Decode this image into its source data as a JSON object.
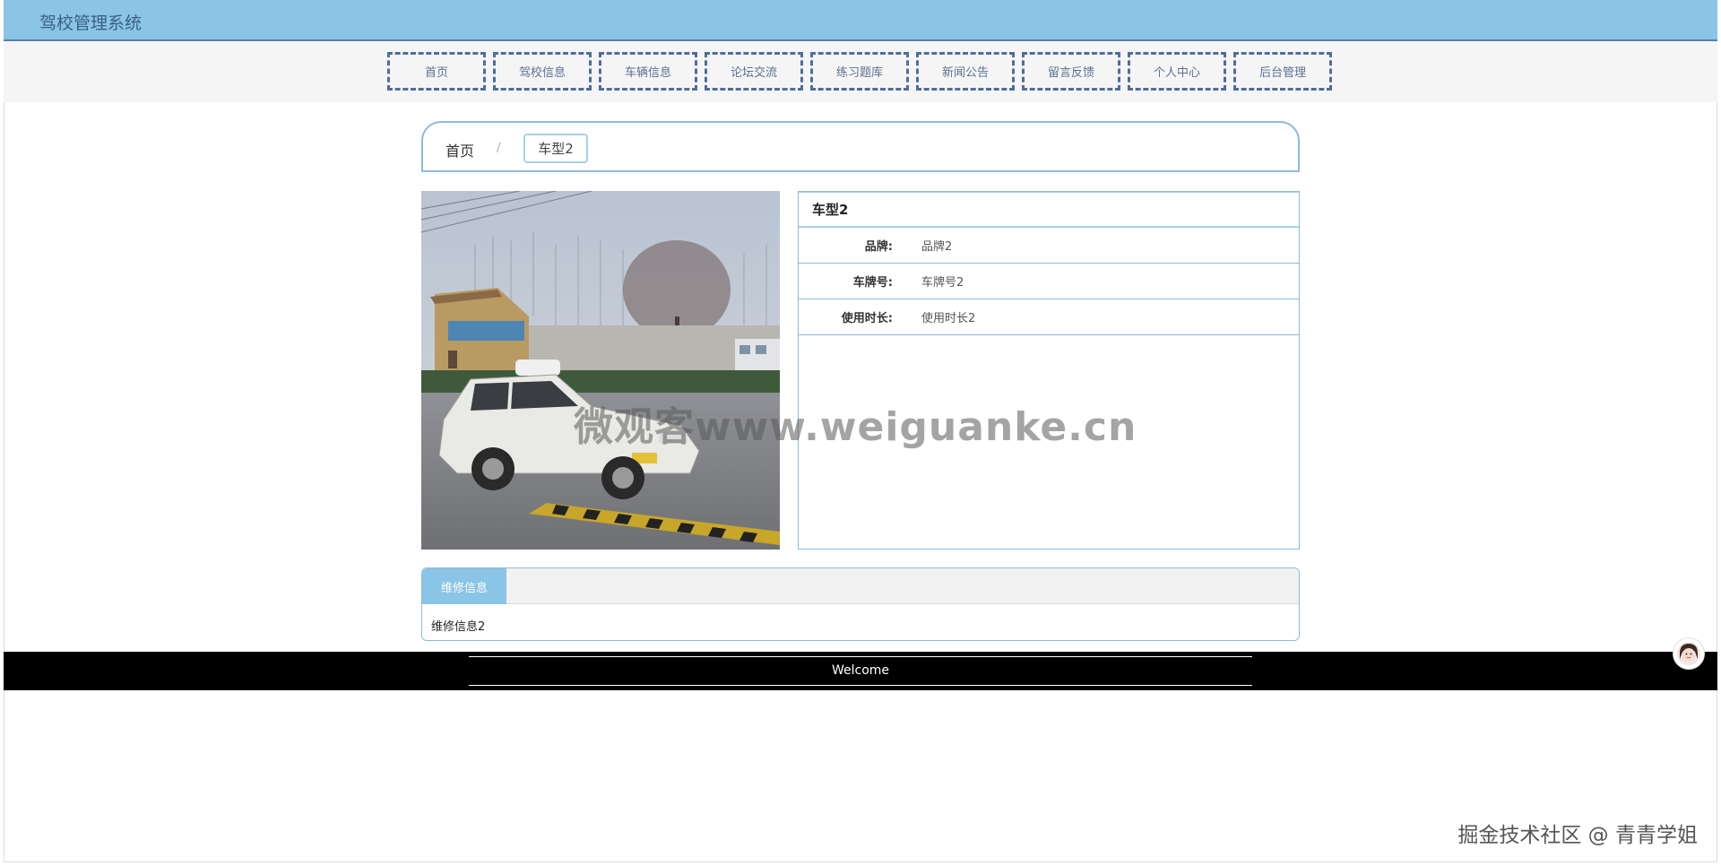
{
  "app": {
    "title": "驾校管理系统"
  },
  "nav": {
    "items": [
      {
        "label": "首页"
      },
      {
        "label": "驾校信息"
      },
      {
        "label": "车辆信息"
      },
      {
        "label": "论坛交流"
      },
      {
        "label": "练习题库"
      },
      {
        "label": "新闻公告"
      },
      {
        "label": "留言反馈"
      },
      {
        "label": "个人中心"
      },
      {
        "label": "后台管理"
      }
    ]
  },
  "breadcrumb": {
    "home": "首页",
    "separator": "/",
    "current": "车型2"
  },
  "detail": {
    "title": "车型2",
    "fields": [
      {
        "label": "品牌:",
        "value": "品牌2"
      },
      {
        "label": "车牌号:",
        "value": "车牌号2"
      },
      {
        "label": "使用时长:",
        "value": "使用时长2"
      }
    ]
  },
  "watermark": "微观客www.weiguanke.cn",
  "tabs": {
    "active_label": "维修信息",
    "content": "维修信息2"
  },
  "footer": {
    "text": "Welcome"
  },
  "credit": "掘金技术社区 @ 青青学姐",
  "colors": {
    "header": "#8ac4e6",
    "nav_border": "#4d6e9c",
    "panel_border": "#8fbad6",
    "footer": "#000000"
  }
}
